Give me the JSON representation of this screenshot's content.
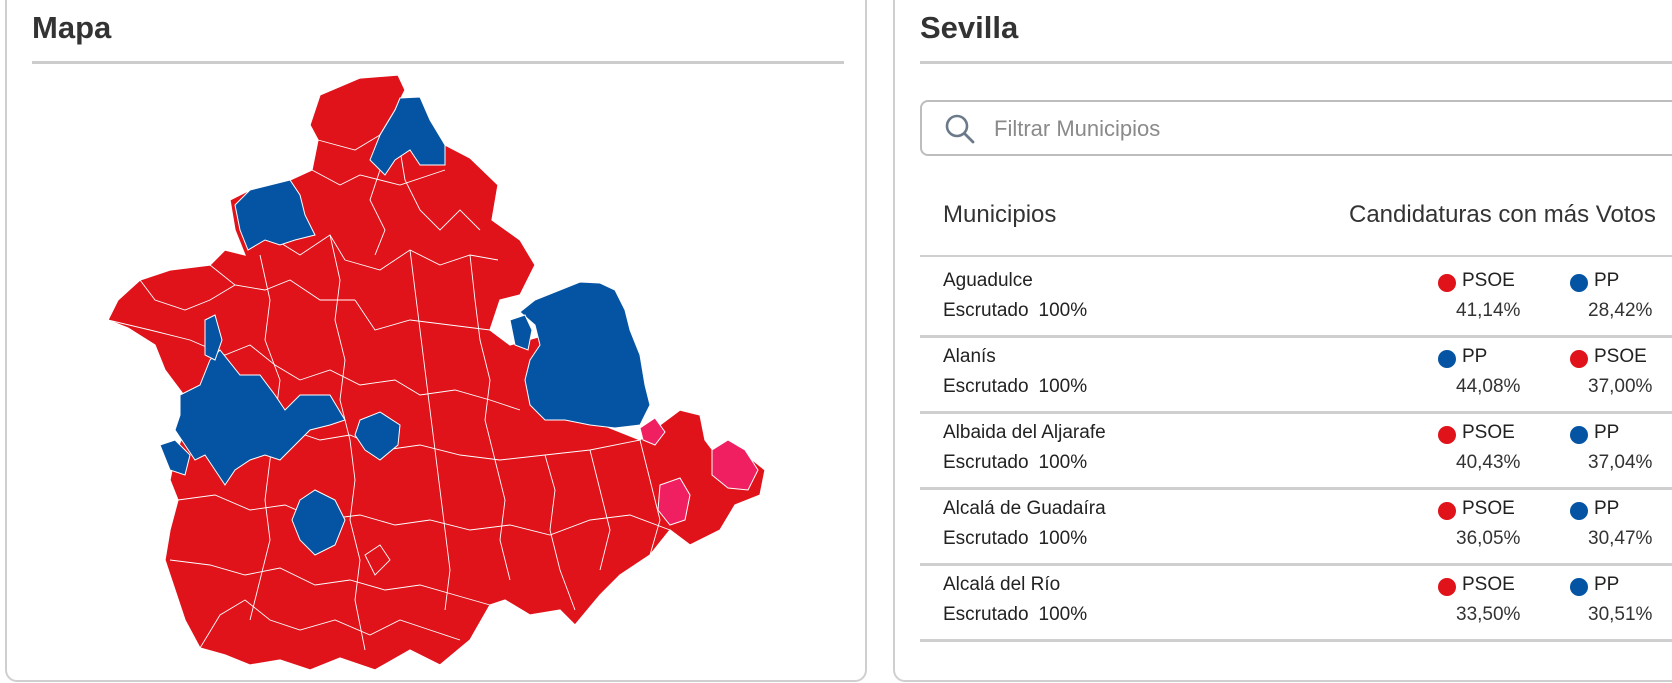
{
  "colors": {
    "PSOE": "#e0121a",
    "PP": "#0554a4",
    "other": "#ef1f62",
    "border": "#cfcfcf"
  },
  "map_panel": {
    "title": "Mapa"
  },
  "list_panel": {
    "title": "Sevilla",
    "search": {
      "placeholder": "Filtrar Municipios",
      "value": "",
      "icon": "search-icon"
    },
    "headers": {
      "municipios": "Municipios",
      "candidaturas": "Candidaturas con más Votos"
    },
    "rows": [
      {
        "name": "Aguadulce",
        "status": "Escrutado",
        "scrutinized": "100%",
        "first": {
          "party": "PSOE",
          "share": "41,14%"
        },
        "second": {
          "party": "PP",
          "share": "28,42%"
        }
      },
      {
        "name": "Alanís",
        "status": "Escrutado",
        "scrutinized": "100%",
        "first": {
          "party": "PP",
          "share": "44,08%"
        },
        "second": {
          "party": "PSOE",
          "share": "37,00%"
        }
      },
      {
        "name": "Albaida del Aljarafe",
        "status": "Escrutado",
        "scrutinized": "100%",
        "first": {
          "party": "PSOE",
          "share": "40,43%"
        },
        "second": {
          "party": "PP",
          "share": "37,04%"
        }
      },
      {
        "name": "Alcalá de Guadaíra",
        "status": "Escrutado",
        "scrutinized": "100%",
        "first": {
          "party": "PSOE",
          "share": "36,05%"
        },
        "second": {
          "party": "PP",
          "share": "30,47%"
        }
      },
      {
        "name": "Alcalá del Río",
        "status": "Escrutado",
        "scrutinized": "100%",
        "first": {
          "party": "PSOE",
          "share": "33,50%"
        },
        "second": {
          "party": "PP",
          "share": "30,51%"
        }
      }
    ]
  }
}
